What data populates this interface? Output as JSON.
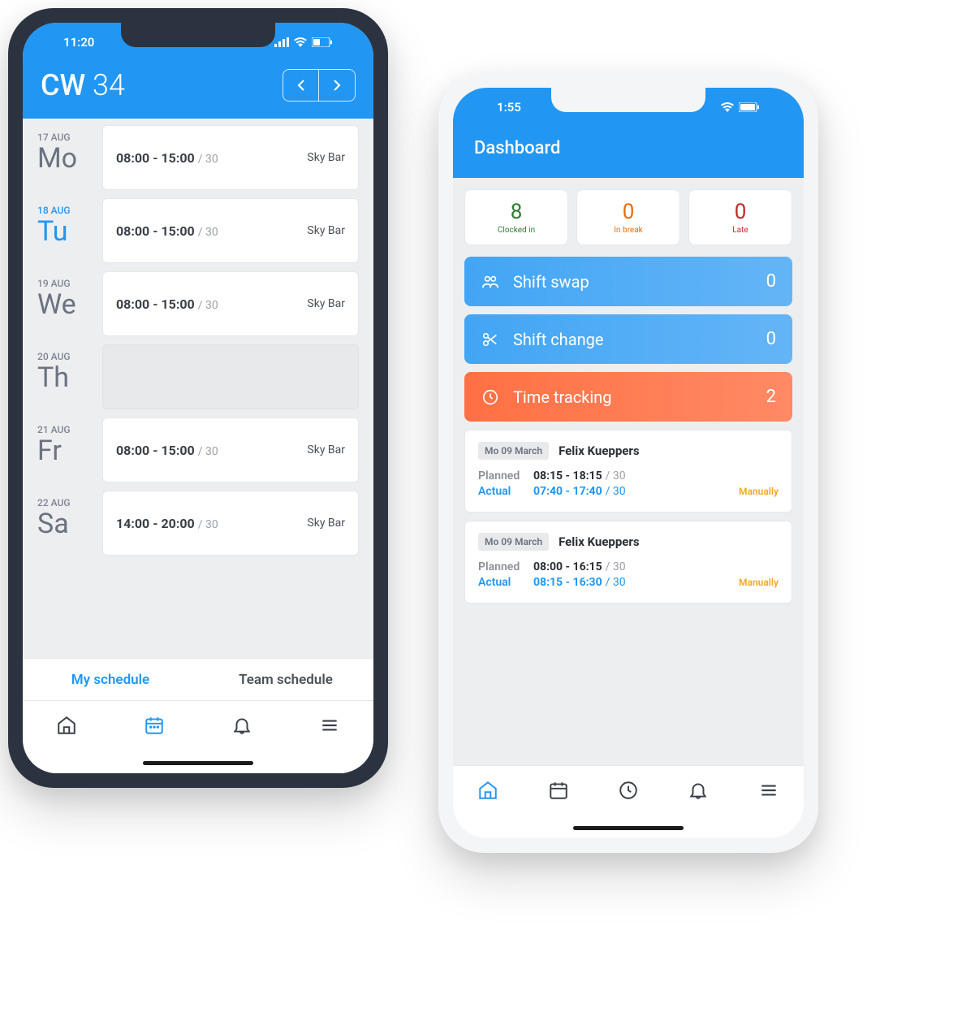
{
  "phone1": {
    "status_time": "11:20",
    "header": {
      "cw_label": "CW",
      "cw_num": "34"
    },
    "days": [
      {
        "date": "17 AUG",
        "abbr": "Mo",
        "active": false,
        "shift": {
          "time": "08:00 - 15:00",
          "dur": "/ 30",
          "loc": "Sky Bar"
        }
      },
      {
        "date": "18 AUG",
        "abbr": "Tu",
        "active": true,
        "shift": {
          "time": "08:00 - 15:00",
          "dur": "/ 30",
          "loc": "Sky Bar"
        }
      },
      {
        "date": "19 AUG",
        "abbr": "We",
        "active": false,
        "shift": {
          "time": "08:00 - 15:00",
          "dur": "/ 30",
          "loc": "Sky Bar"
        }
      },
      {
        "date": "20 AUG",
        "abbr": "Th",
        "active": false,
        "shift": null
      },
      {
        "date": "21 AUG",
        "abbr": "Fr",
        "active": false,
        "shift": {
          "time": "08:00 - 15:00",
          "dur": "/ 30",
          "loc": "Sky Bar"
        }
      },
      {
        "date": "22 AUG",
        "abbr": "Sa",
        "active": false,
        "shift": {
          "time": "14:00 - 20:00",
          "dur": "/ 30",
          "loc": "Sky Bar"
        }
      }
    ],
    "tabs": {
      "my": "My schedule",
      "team": "Team schedule"
    }
  },
  "phone2": {
    "status_time": "1:55",
    "title": "Dashboard",
    "stats": [
      {
        "num": "8",
        "lbl": "Clocked in",
        "cls": "green"
      },
      {
        "num": "0",
        "lbl": "In break",
        "cls": "orange"
      },
      {
        "num": "0",
        "lbl": "Late",
        "cls": "red"
      }
    ],
    "actions": [
      {
        "lbl": "Shift swap",
        "cnt": "0",
        "cls": "ac-blue",
        "icon": "users-icon"
      },
      {
        "lbl": "Shift change",
        "cnt": "0",
        "cls": "ac-blue",
        "icon": "scissors-icon"
      },
      {
        "lbl": "Time tracking",
        "cnt": "2",
        "cls": "ac-orange",
        "icon": "clock-icon"
      }
    ],
    "entries": [
      {
        "date": "Mo 09 March",
        "name": "Felix Kueppers",
        "planned_label": "Planned",
        "planned_time": "08:15 - 18:15",
        "planned_dur": "/ 30",
        "actual_label": "Actual",
        "actual_time": "07:40 - 17:40",
        "actual_dur": "/ 30",
        "tag": "Manually"
      },
      {
        "date": "Mo 09 March",
        "name": "Felix Kueppers",
        "planned_label": "Planned",
        "planned_time": "08:00 - 16:15",
        "planned_dur": "/ 30",
        "actual_label": "Actual",
        "actual_time": "08:15 - 16:30",
        "actual_dur": "/ 30",
        "tag": "Manually"
      }
    ]
  }
}
